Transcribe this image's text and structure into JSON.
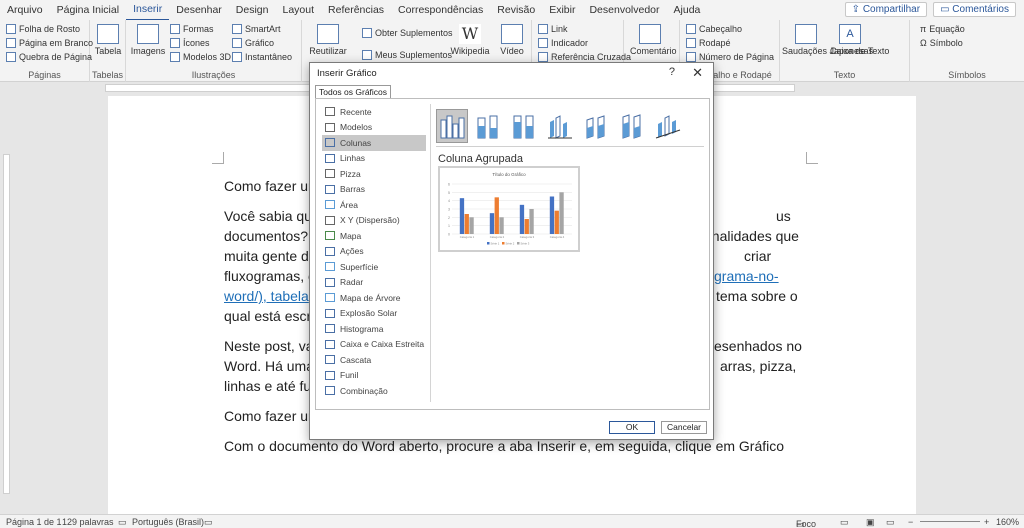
{
  "menu": {
    "tabs": [
      "Arquivo",
      "Página Inicial",
      "Inserir",
      "Desenhar",
      "Design",
      "Layout",
      "Referências",
      "Correspondências",
      "Revisão",
      "Exibir",
      "Desenvolvedor",
      "Ajuda"
    ],
    "share_label": "Compartilhar",
    "comments_label": "Comentários"
  },
  "ribbon": {
    "pages": {
      "items": [
        "Folha de Rosto",
        "Página em Branco",
        "Quebra de Página"
      ],
      "label": "Páginas"
    },
    "tables": {
      "table": "Tabela",
      "label": "Tabelas"
    },
    "illustrations": {
      "images": "Imagens",
      "shapes": "Formas",
      "icons": "Ícones",
      "models3d": "Modelos 3D",
      "smartart": "SmartArt",
      "chart": "Gráfico",
      "screenshot": "Instantâneo",
      "label": "Ilustrações"
    },
    "addins": {
      "reuse": "Reutilizar",
      "get": "Obter Suplementos",
      "mine": "Meus Suplementos",
      "wikipedia": "Wikipedia",
      "video": "Vídeo"
    },
    "links": {
      "link": "Link",
      "bookmark": "Indicador",
      "crossref": "Referência Cruzada"
    },
    "comment": "Comentário",
    "header": {
      "header": "Cabeçalho",
      "footer": "Rodapé",
      "page_number": "Número de Página",
      "label": "Cabeçalho e Rodapé"
    },
    "text": {
      "greetings": "Saudações Japonesas",
      "textbox": "Caixa de Texto",
      "label": "Texto"
    },
    "symbols": {
      "equation": "Equação",
      "symbol": "Símbolo",
      "label": "Símbolos"
    }
  },
  "document": {
    "lines": [
      "Como fazer um",
      "Você sabia que",
      "us",
      "documentos?",
      "onalidades que",
      "muita gente d",
      "criar",
      "fluxogramas, c",
      "grama-no-",
      "word/), tabela",
      "tema sobre o",
      "qual está escr",
      "Neste post, va",
      "esenhados no",
      "Word. Há uma",
      "arras, pizza,",
      "linhas e até fu",
      "Como fazer um",
      "Com o documento do Word aberto, procure a aba Inserir e, em seguida, clique em Gráfico"
    ]
  },
  "dialog": {
    "title": "Inserir Gráfico",
    "help": "?",
    "close": "✕",
    "tab": "Todos os Gráficos",
    "chart_types": [
      "Recente",
      "Modelos",
      "Colunas",
      "Linhas",
      "Pizza",
      "Barras",
      "Área",
      "X Y (Dispersão)",
      "Mapa",
      "Ações",
      "Superfície",
      "Radar",
      "Mapa de Árvore",
      "Explosão Solar",
      "Histograma",
      "Caixa e Caixa Estreita",
      "Cascata",
      "Funil",
      "Combinação"
    ],
    "selected_type": "Colunas",
    "subtype_name": "Coluna Agrupada",
    "ok": "OK",
    "cancel": "Cancelar"
  },
  "status": {
    "page": "Página 1 de 1",
    "words": "129 palavras",
    "language": "Português (Brasil)",
    "focus": "Foco",
    "zoom": "160%"
  },
  "chart_data": {
    "type": "bar",
    "title": "Título do Gráfico",
    "categories": [
      "Categoria 1",
      "Categoria 2",
      "Categoria 3",
      "Categoria 4"
    ],
    "series": [
      {
        "name": "Série 1",
        "values": [
          4.3,
          2.5,
          3.5,
          4.5
        ],
        "color": "#4472c4"
      },
      {
        "name": "Série 2",
        "values": [
          2.4,
          4.4,
          1.8,
          2.8
        ],
        "color": "#ed7d31"
      },
      {
        "name": "Série 3",
        "values": [
          2,
          2,
          3,
          5
        ],
        "color": "#a5a5a5"
      }
    ],
    "ylim": [
      0,
      6
    ],
    "grid": true,
    "legend": "bottom"
  }
}
